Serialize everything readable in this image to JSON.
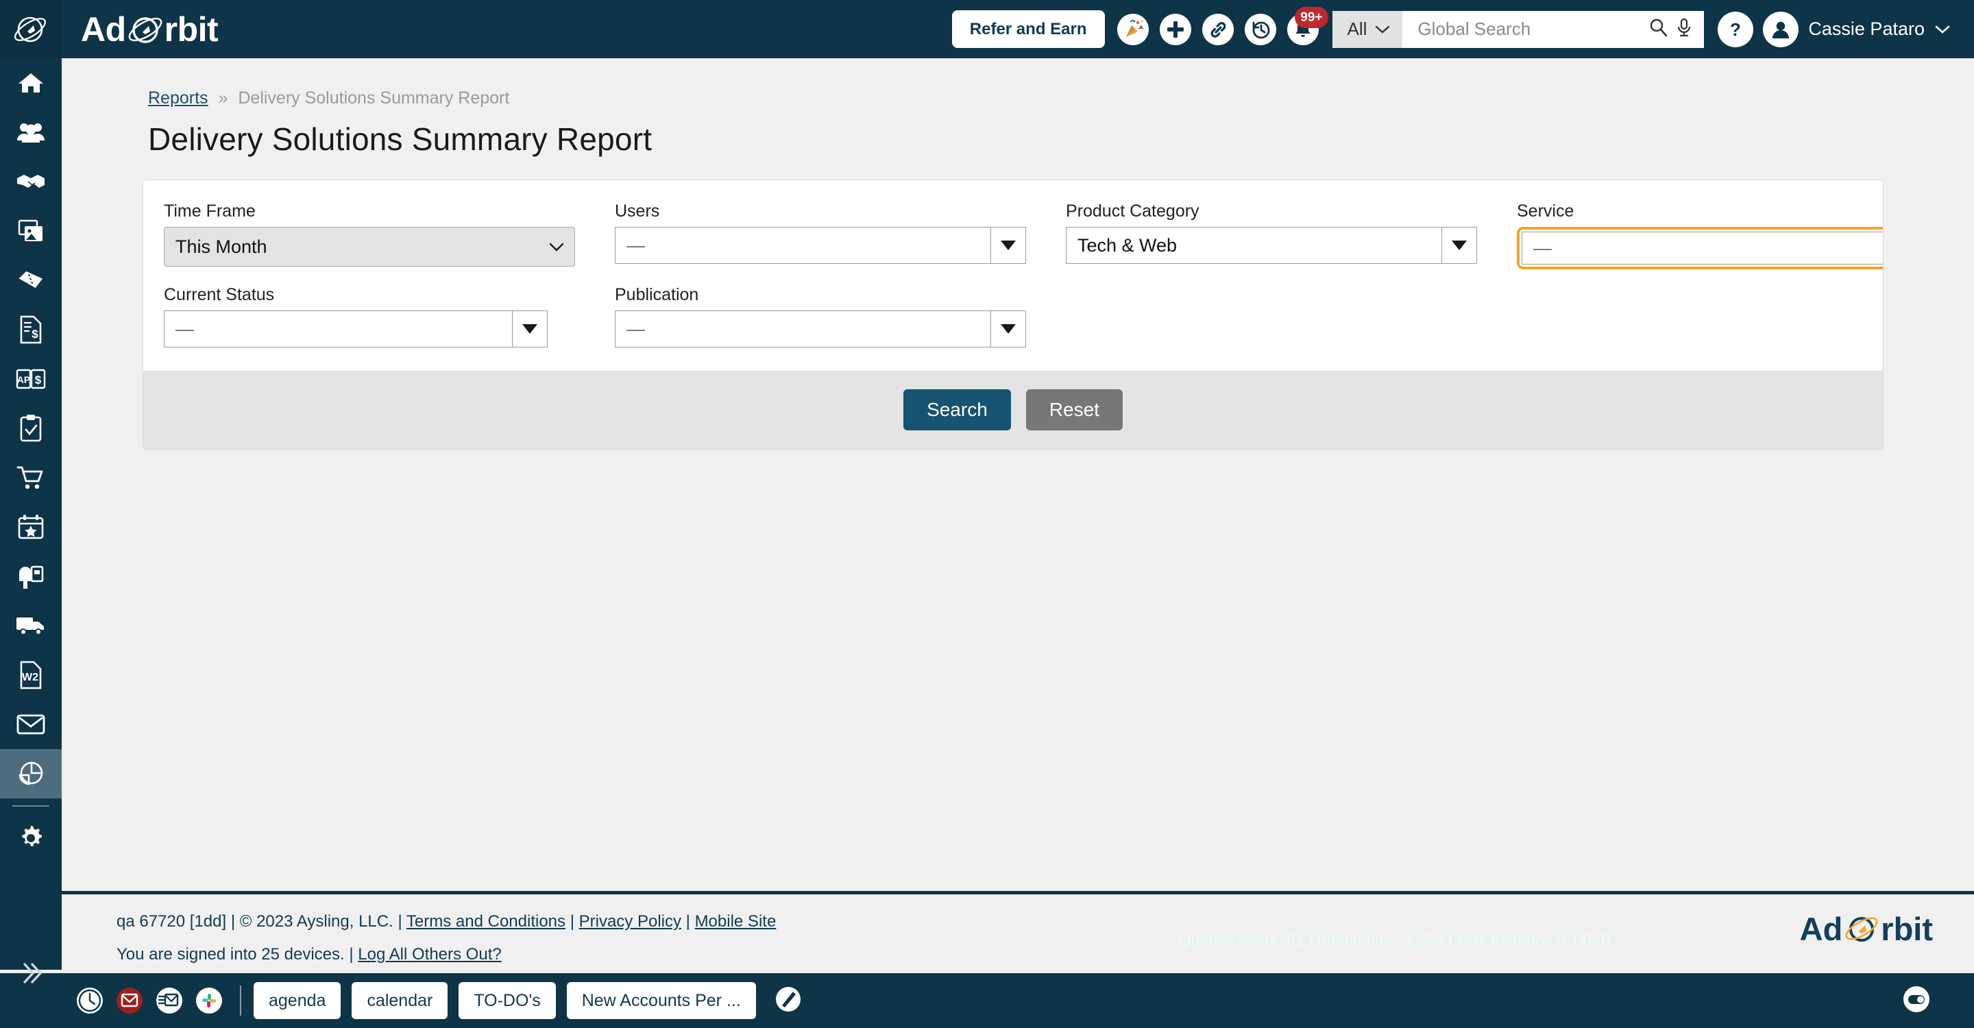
{
  "app": {
    "brand_ad": "Ad",
    "brand_rbit": "rbit"
  },
  "topbar": {
    "refer_label": "Refer and Earn",
    "icons": [
      {
        "name": "party-popper-icon",
        "label": "Whats New"
      },
      {
        "name": "plus-icon",
        "label": "Add"
      },
      {
        "name": "link-icon",
        "label": "Quick Links"
      },
      {
        "name": "history-clock-icon",
        "label": "Recent History"
      },
      {
        "name": "bell-icon",
        "label": "Notifications"
      }
    ],
    "notification_badge": "99+",
    "search_scope": "All",
    "search_placeholder": "Global Search",
    "search_value": "",
    "help_label": "Help",
    "user_name": "Cassie Pataro"
  },
  "sidebar": {
    "items": [
      {
        "name": "sidebar-item-home",
        "icon": "home-icon",
        "label": "Home",
        "active": false
      },
      {
        "name": "sidebar-item-contacts",
        "icon": "users-group-icon",
        "label": "Contacts",
        "active": false
      },
      {
        "name": "sidebar-item-deals",
        "icon": "handshake-icon",
        "label": "Deals",
        "active": false
      },
      {
        "name": "sidebar-item-media",
        "icon": "images-icon",
        "label": "Media",
        "active": false
      },
      {
        "name": "sidebar-item-tickets",
        "icon": "ticket-icon",
        "label": "Tickets",
        "active": false
      },
      {
        "name": "sidebar-item-invoices",
        "icon": "invoice-dollar-icon",
        "label": "Invoices",
        "active": false
      },
      {
        "name": "sidebar-item-accounts-payable",
        "icon": "ap-book-dollar-icon",
        "label": "Accounts Payable",
        "active": false
      },
      {
        "name": "sidebar-item-tasks",
        "icon": "clipboard-check-icon",
        "label": "Tasks",
        "active": false
      },
      {
        "name": "sidebar-item-orders",
        "icon": "shopping-cart-icon",
        "label": "Orders",
        "active": false
      },
      {
        "name": "sidebar-item-events",
        "icon": "calendar-star-icon",
        "label": "Events",
        "active": false
      },
      {
        "name": "sidebar-item-mailbox",
        "icon": "mailbox-icon",
        "label": "Mailbox",
        "active": false
      },
      {
        "name": "sidebar-item-shipping",
        "icon": "truck-icon",
        "label": "Shipping",
        "active": false
      },
      {
        "name": "sidebar-item-w2",
        "icon": "w2-document-icon",
        "label": "W2",
        "active": false
      },
      {
        "name": "sidebar-item-email",
        "icon": "envelope-icon",
        "label": "Email",
        "active": false
      },
      {
        "name": "sidebar-item-reports",
        "icon": "pie-chart-icon",
        "label": "Reports",
        "active": true
      },
      {
        "name": "sidebar-item-settings",
        "icon": "gear-icon",
        "label": "Settings",
        "active": false
      }
    ],
    "expand_icon": "double-chevron-right-icon"
  },
  "breadcrumb": {
    "parent": "Reports",
    "separator": "»",
    "current": "Delivery Solutions Summary Report"
  },
  "page": {
    "title": "Delivery Solutions Summary Report"
  },
  "filters": {
    "row1": [
      {
        "name": "time-frame",
        "label": "Time Frame",
        "value": "This Month",
        "kind": "native",
        "placeholder": "",
        "focused": false
      },
      {
        "name": "users",
        "label": "Users",
        "value": "—",
        "kind": "chosen",
        "focused": false
      },
      {
        "name": "product-category",
        "label": "Product Category",
        "value": "Tech & Web",
        "kind": "chosen",
        "focused": false
      },
      {
        "name": "service",
        "label": "Service",
        "value": "—",
        "kind": "chosen",
        "focused": true
      }
    ],
    "row2": [
      {
        "name": "current-status",
        "label": "Current Status",
        "value": "—",
        "kind": "chosen",
        "focused": false
      },
      {
        "name": "publication",
        "label": "Publication",
        "value": "—",
        "kind": "chosen",
        "focused": false
      }
    ],
    "search_label": "Search",
    "reset_label": "Reset"
  },
  "footer": {
    "build": "qa 67720 [1dd] | © 2023 Aysling, LLC. |",
    "terms": "Terms and Conditions",
    "pipe1": "|",
    "privacy": "Privacy Policy",
    "pipe2": "|",
    "mobile": "Mobile Site",
    "devices_text": "You are signed into 25 devices. |",
    "logout_link": "Log All Others Out?",
    "stats": "Queries Made: 61 | render time: 1.28s | Max memory: 9.14MB",
    "brand_ad": "Ad",
    "brand_rbit": "rbit"
  },
  "taskbar": {
    "icons": [
      {
        "name": "clock-icon",
        "label": "Timer"
      },
      {
        "name": "mail-unread-icon",
        "label": "Unread Mail"
      },
      {
        "name": "mail-open-icon",
        "label": "Open Mail"
      },
      {
        "name": "slack-icon",
        "label": "Slack"
      }
    ],
    "tabs": [
      {
        "name": "taskbar-tab-agenda",
        "label": "agenda"
      },
      {
        "name": "taskbar-tab-calendar",
        "label": "calendar"
      },
      {
        "name": "taskbar-tab-todos",
        "label": "TO-DO's"
      },
      {
        "name": "taskbar-tab-new-accounts",
        "label": "New Accounts Per ..."
      }
    ],
    "pen_icon": "pen-circle-icon",
    "toggle_icon": "toggle-switch-icon"
  },
  "colors": {
    "navy": "#0e3448",
    "accent_orange": "#f5a623",
    "search_button": "#155371",
    "reset_button": "#777777",
    "badge_red": "#c0272d"
  }
}
